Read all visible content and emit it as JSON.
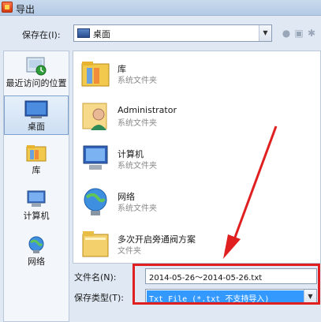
{
  "window": {
    "title": "导出"
  },
  "toolbar": {
    "save_in_label": "保存在(I):",
    "location": "桌面",
    "icons": [
      "combo-dropdown",
      "back-icon",
      "up-folder-icon",
      "new-folder-icon",
      "view-menu-icon"
    ]
  },
  "places": [
    {
      "label": "最近访问的位置",
      "icon": "recent-places-icon"
    },
    {
      "label": "桌面",
      "icon": "desktop-icon",
      "selected": true
    },
    {
      "label": "库",
      "icon": "libraries-icon"
    },
    {
      "label": "计算机",
      "icon": "computer-icon"
    },
    {
      "label": "网络",
      "icon": "network-icon"
    }
  ],
  "files": [
    {
      "name": "库",
      "type": "系统文件夹",
      "icon": "libraries-icon"
    },
    {
      "name": "Administrator",
      "type": "系统文件夹",
      "icon": "user-icon"
    },
    {
      "name": "计算机",
      "type": "系统文件夹",
      "icon": "computer-icon"
    },
    {
      "name": "网络",
      "type": "系统文件夹",
      "icon": "network-icon"
    },
    {
      "name": "多次开启旁通阀方案",
      "type": "文件夹",
      "icon": "folder-icon"
    }
  ],
  "form": {
    "filename_label": "文件名(N):",
    "filename_value": "2014-05-26～2014-05-26.txt",
    "filetype_label": "保存类型(T):",
    "filetype_value": "Txt File (*.txt 不支持导入)"
  },
  "colors": {
    "highlight": "#e02020",
    "selection": "#3399ff"
  }
}
